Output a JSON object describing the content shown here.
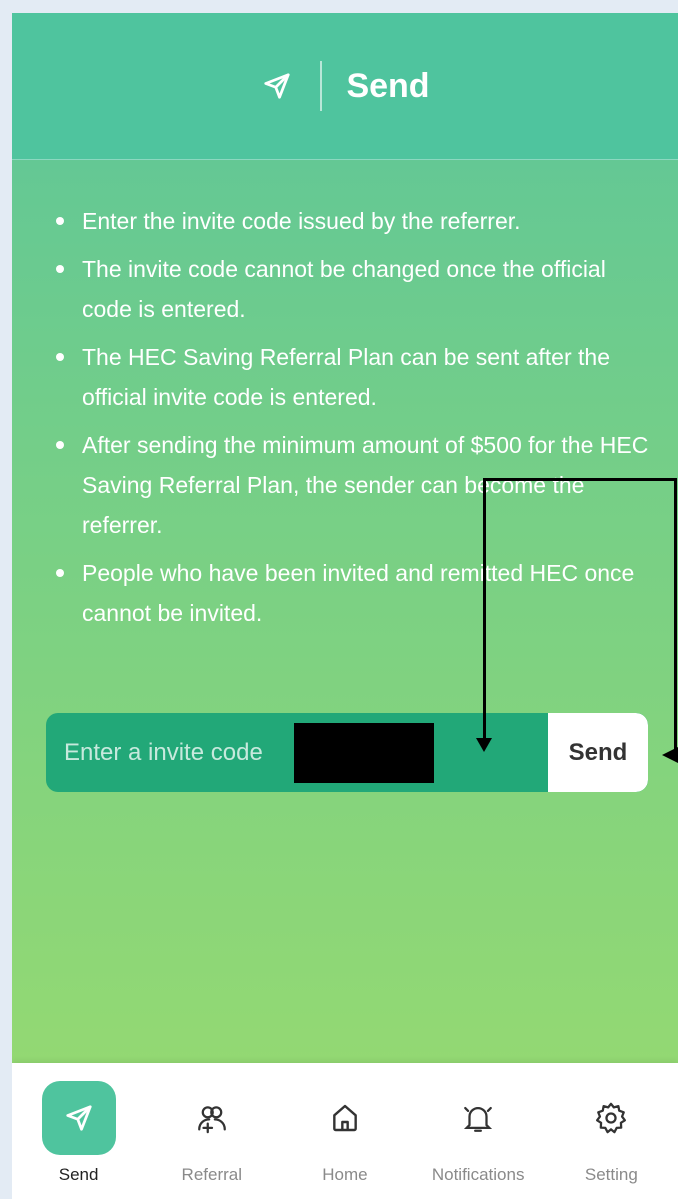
{
  "header": {
    "title": "Send",
    "icon": "send-icon"
  },
  "rules": [
    "Enter the invite code issued by the referrer.",
    "The invite code cannot be changed once the official code is entered.",
    "The HEC Saving Referral Plan can be sent after the official invite code is entered.",
    "After sending the minimum amount of $500 for the HEC Saving Referral Plan, the sender can become the referrer.",
    "People who have been invited and remitted HEC once cannot be invited."
  ],
  "invite": {
    "placeholder": "Enter a invite code",
    "value": "",
    "send_label": "Send"
  },
  "tabs": [
    {
      "label": "Send",
      "icon": "send-icon",
      "active": true
    },
    {
      "label": "Referral",
      "icon": "referral-icon",
      "active": false
    },
    {
      "label": "Home",
      "icon": "home-icon",
      "active": false
    },
    {
      "label": "Notifications",
      "icon": "bell-icon",
      "active": false
    },
    {
      "label": "Setting",
      "icon": "gear-icon",
      "active": false
    }
  ],
  "colors": {
    "header": "#4fc49e",
    "input_bar": "#22a878",
    "accent": "#4fc49e"
  }
}
